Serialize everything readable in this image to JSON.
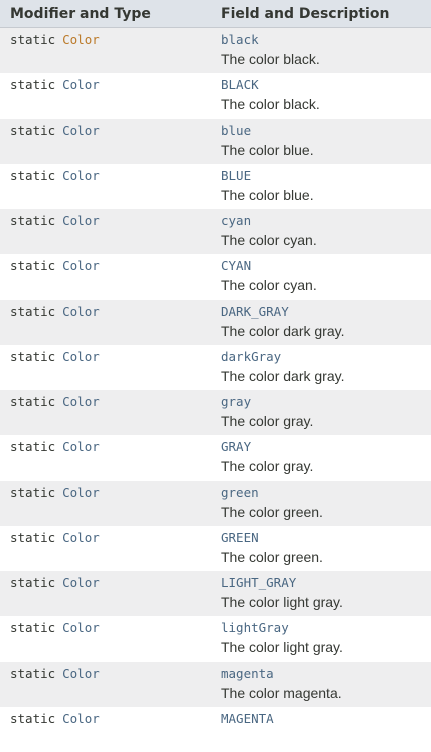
{
  "table": {
    "header": {
      "col1": "Modifier and Type",
      "col2": "Field and Description"
    },
    "rows": [
      {
        "modifier": "static",
        "type": "Color",
        "field": "black",
        "description": "The color black."
      },
      {
        "modifier": "static",
        "type": "Color",
        "field": "BLACK",
        "description": "The color black."
      },
      {
        "modifier": "static",
        "type": "Color",
        "field": "blue",
        "description": "The color blue."
      },
      {
        "modifier": "static",
        "type": "Color",
        "field": "BLUE",
        "description": "The color blue."
      },
      {
        "modifier": "static",
        "type": "Color",
        "field": "cyan",
        "description": "The color cyan."
      },
      {
        "modifier": "static",
        "type": "Color",
        "field": "CYAN",
        "description": "The color cyan."
      },
      {
        "modifier": "static",
        "type": "Color",
        "field": "DARK_GRAY",
        "description": "The color dark gray."
      },
      {
        "modifier": "static",
        "type": "Color",
        "field": "darkGray",
        "description": "The color dark gray."
      },
      {
        "modifier": "static",
        "type": "Color",
        "field": "gray",
        "description": "The color gray."
      },
      {
        "modifier": "static",
        "type": "Color",
        "field": "GRAY",
        "description": "The color gray."
      },
      {
        "modifier": "static",
        "type": "Color",
        "field": "green",
        "description": "The color green."
      },
      {
        "modifier": "static",
        "type": "Color",
        "field": "GREEN",
        "description": "The color green."
      },
      {
        "modifier": "static",
        "type": "Color",
        "field": "LIGHT_GRAY",
        "description": "The color light gray."
      },
      {
        "modifier": "static",
        "type": "Color",
        "field": "lightGray",
        "description": "The color light gray."
      },
      {
        "modifier": "static",
        "type": "Color",
        "field": "magenta",
        "description": "The color magenta."
      },
      {
        "modifier": "static",
        "type": "Color",
        "field": "MAGENTA",
        "description": ""
      }
    ]
  },
  "colors": {
    "header_bg": "#dee3e9",
    "alt_row_bg": "#eeeeef",
    "link": "#4a6782",
    "visited_link": "#bb7a2a",
    "text": "#353833"
  }
}
